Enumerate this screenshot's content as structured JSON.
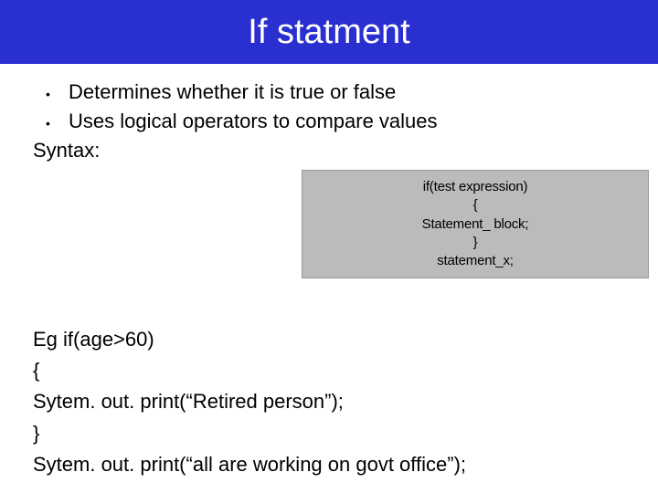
{
  "title": "If statment",
  "bullets": [
    "Determines whether it is true or false",
    "Uses logical operators to compare values"
  ],
  "syntaxLabel": "Syntax:",
  "code": {
    "l1": "if(test expression)",
    "l2": "{",
    "l3": "Statement_ block;",
    "l4": "}",
    "l5": "statement_x;"
  },
  "example": {
    "l1": "Eg if(age>60)",
    "l2": "{",
    "l3": "Sytem. out. print(“Retired person”);",
    "l4": "}",
    "l5": "Sytem. out. print(“all are working on govt office”);"
  }
}
